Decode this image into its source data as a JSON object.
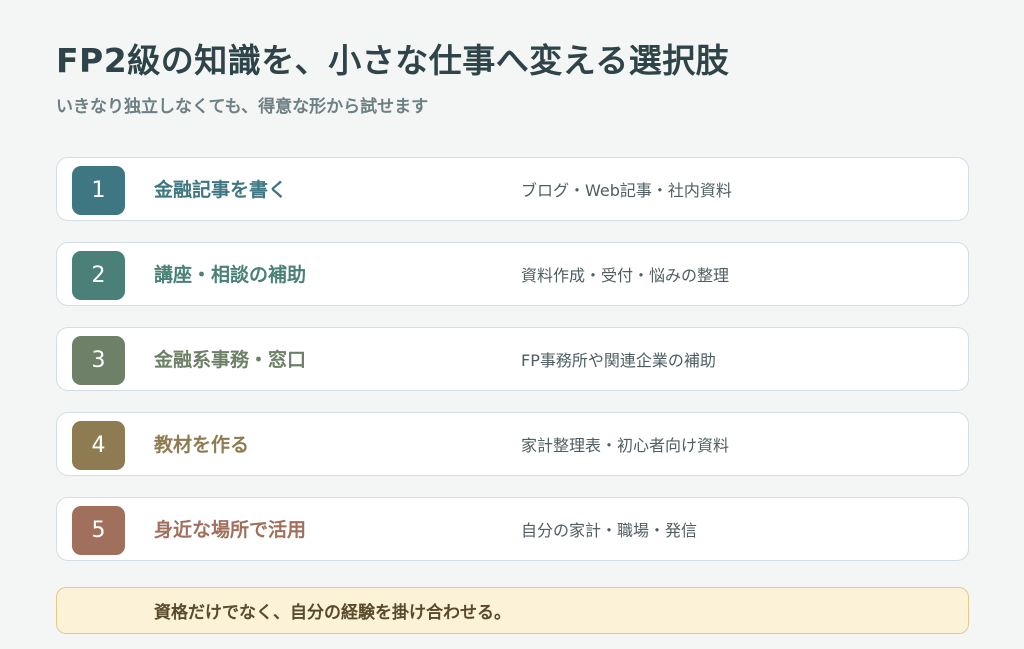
{
  "title": "FP2級の知識を、小さな仕事へ変える選択肢",
  "subtitle": "いきなり独立しなくても、得意な形から試せます",
  "items": [
    {
      "number": "1",
      "label": "金融記事を書く",
      "desc": "ブログ・Web記事・社内資料",
      "color": "#3e7781"
    },
    {
      "number": "2",
      "label": "講座・相談の補助",
      "desc": "資料作成・受付・悩みの整理",
      "color": "#4a8078"
    },
    {
      "number": "3",
      "label": "金融系事務・窓口",
      "desc": "FP事務所や関連企業の補助",
      "color": "#6e8068"
    },
    {
      "number": "4",
      "label": "教材を作る",
      "desc": "家計整理表・初心者向け資料",
      "color": "#8e7b52"
    },
    {
      "number": "5",
      "label": "身近な場所で活用",
      "desc": "自分の家計・職場・発信",
      "color": "#a0705c"
    }
  ],
  "footer": "資格だけでなく、自分の経験を掛け合わせる。"
}
